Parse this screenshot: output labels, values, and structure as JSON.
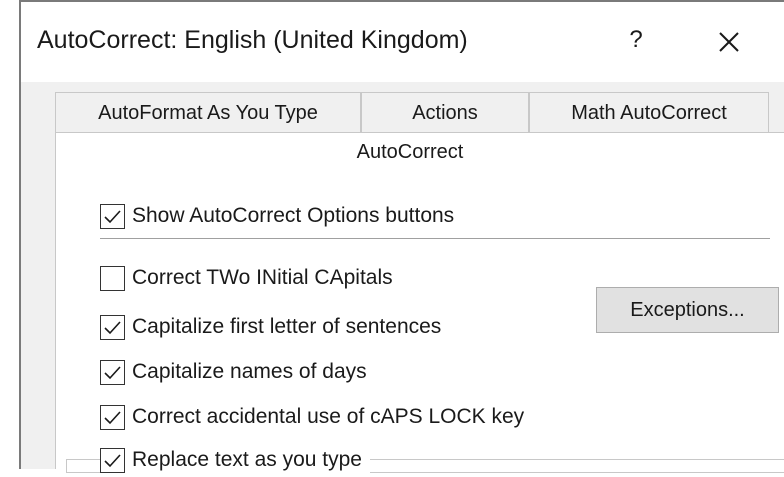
{
  "dialog": {
    "title": "AutoCorrect: English (United Kingdom)",
    "help_label": "?",
    "close_icon": "close-icon"
  },
  "tabs": [
    {
      "label": "AutoFormat As You Type"
    },
    {
      "label": "Actions"
    },
    {
      "label": "Math AutoCorrect"
    }
  ],
  "active_tab": {
    "label": "AutoCorrect"
  },
  "options": {
    "show_buttons": {
      "label": "Show AutoCorrect Options buttons",
      "checked": true
    },
    "two_initial_caps": {
      "label": "Correct TWo INitial CApitals",
      "checked": false
    },
    "capitalize_first": {
      "label": "Capitalize first letter of sentences",
      "checked": true
    },
    "capitalize_days": {
      "label": "Capitalize names of days",
      "checked": true
    },
    "caps_lock": {
      "label": "Correct accidental use of cAPS LOCK key",
      "checked": true
    },
    "replace_text": {
      "label": "Replace text as you type",
      "checked": true
    }
  },
  "buttons": {
    "exceptions": "Exceptions..."
  },
  "colors": {
    "dialog_bg": "#f0f0f0",
    "panel_bg": "#ffffff",
    "button_bg": "#e1e1e1"
  }
}
